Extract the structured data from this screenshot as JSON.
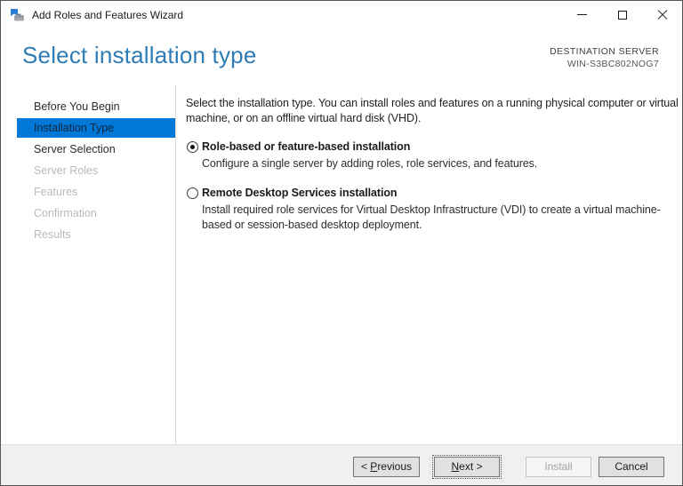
{
  "window": {
    "title": "Add Roles and Features Wizard"
  },
  "icons": {
    "app": "server-manager-flag-and-toolbox",
    "minimize": "thin horizontal bar",
    "maximize": "hollow square",
    "close": "diagonal cross"
  },
  "colors": {
    "accent_blue": "#0078d7",
    "heading_blue": "#2e7cb5",
    "footer_gray": "#f0f0f0"
  },
  "header": {
    "title": "Select installation type",
    "destination_label": "DESTINATION SERVER",
    "destination_server": "WIN-S3BC802NOG7"
  },
  "sidebar": {
    "items": [
      {
        "label": "Before You Begin",
        "state": "enabled"
      },
      {
        "label": "Installation Type",
        "state": "selected"
      },
      {
        "label": "Server Selection",
        "state": "enabled"
      },
      {
        "label": "Server Roles",
        "state": "disabled"
      },
      {
        "label": "Features",
        "state": "disabled"
      },
      {
        "label": "Confirmation",
        "state": "disabled"
      },
      {
        "label": "Results",
        "state": "disabled"
      }
    ]
  },
  "content": {
    "intro": "Select the installation type. You can install roles and features on a running physical computer or virtual machine, or on an offline virtual hard disk (VHD).",
    "options": [
      {
        "label": "Role-based or feature-based installation",
        "description": "Configure a single server by adding roles, role services, and features.",
        "selected": true
      },
      {
        "label": "Remote Desktop Services installation",
        "description": "Install required role services for Virtual Desktop Infrastructure (VDI) to create a virtual machine-based or session-based desktop deployment.",
        "selected": false
      }
    ]
  },
  "footer": {
    "previous": {
      "prefix": "< ",
      "accel": "P",
      "rest": "revious"
    },
    "next": {
      "accel": "N",
      "rest": "ext >"
    },
    "install_label": "Install",
    "cancel_label": "Cancel"
  }
}
